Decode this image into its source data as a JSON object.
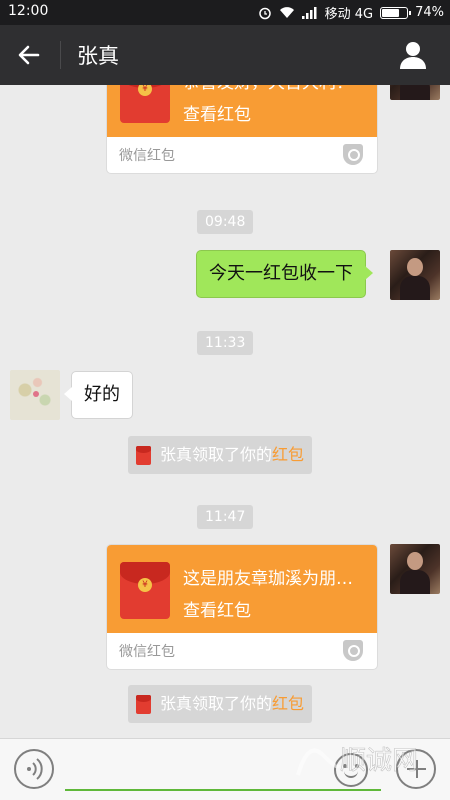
{
  "status_bar": {
    "time": "12:00",
    "carrier": "移动 4G",
    "battery": "74%",
    "battery_level": 0.74
  },
  "nav": {
    "title": "张真"
  },
  "chat": {
    "top_hongbao": {
      "message": "恭喜发财，大吉大利！",
      "open_label": "查看红包",
      "brand": "微信红包"
    },
    "time_1": "09:48",
    "msg_out_1": "今天一红包收一下",
    "time_2": "11:33",
    "msg_in_1": "好的",
    "system_1": {
      "prefix": "张真领取了你的",
      "highlight": "红包"
    },
    "time_3": "11:47",
    "hongbao_2": {
      "message": "这是朋友章珈溪为朋…",
      "open_label": "查看红包",
      "brand": "微信红包"
    },
    "system_2": {
      "prefix": "张真领取了你的",
      "highlight": "红包"
    }
  },
  "colors": {
    "hongbao_orange": "#f89c34",
    "bubble_green": "#a0e75a",
    "nav_bg": "#2f2f31"
  },
  "icons": [
    "back-arrow-icon",
    "user-icon",
    "yuan-coin-icon",
    "shield-icon",
    "voice-icon",
    "emoji-icon",
    "plus-icon"
  ]
}
